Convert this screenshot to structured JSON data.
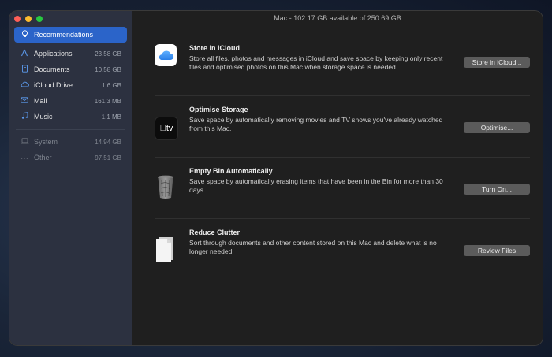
{
  "window": {
    "title": "Mac - 102.17 GB available of 250.69 GB"
  },
  "sidebar": {
    "items": [
      {
        "label": "Recommendations",
        "icon": "lightbulb-icon",
        "size": ""
      },
      {
        "label": "Applications",
        "icon": "applications-icon",
        "size": "23.58 GB"
      },
      {
        "label": "Documents",
        "icon": "document-icon",
        "size": "10.58 GB"
      },
      {
        "label": "iCloud Drive",
        "icon": "cloud-icon",
        "size": "1.6 GB"
      },
      {
        "label": "Mail",
        "icon": "envelope-icon",
        "size": "161.3 MB"
      },
      {
        "label": "Music",
        "icon": "music-note-icon",
        "size": "1.1 MB"
      },
      {
        "label": "System",
        "icon": "laptop-icon",
        "size": "14.94 GB"
      },
      {
        "label": "Other",
        "icon": "ellipsis-icon",
        "size": "97.51 GB"
      }
    ]
  },
  "recommendations": [
    {
      "title": "Store in iCloud",
      "description": "Store all files, photos and messages in iCloud and save space by keeping only recent files and optimised photos on this Mac when storage space is needed.",
      "button": "Store in iCloud...",
      "icon": "icloud-icon"
    },
    {
      "title": "Optimise Storage",
      "description": "Save space by automatically removing movies and TV shows you've already watched from this Mac.",
      "button": "Optimise...",
      "icon": "apple-tv-icon",
      "icon_text": "tv"
    },
    {
      "title": "Empty Bin Automatically",
      "description": "Save space by automatically erasing items that have been in the Bin for more than 30 days.",
      "button": "Turn On...",
      "icon": "trash-bin-icon"
    },
    {
      "title": "Reduce Clutter",
      "description": "Sort through documents and other content stored on this Mac and delete what is no longer needed.",
      "button": "Review Files",
      "icon": "document-pile-icon"
    }
  ]
}
